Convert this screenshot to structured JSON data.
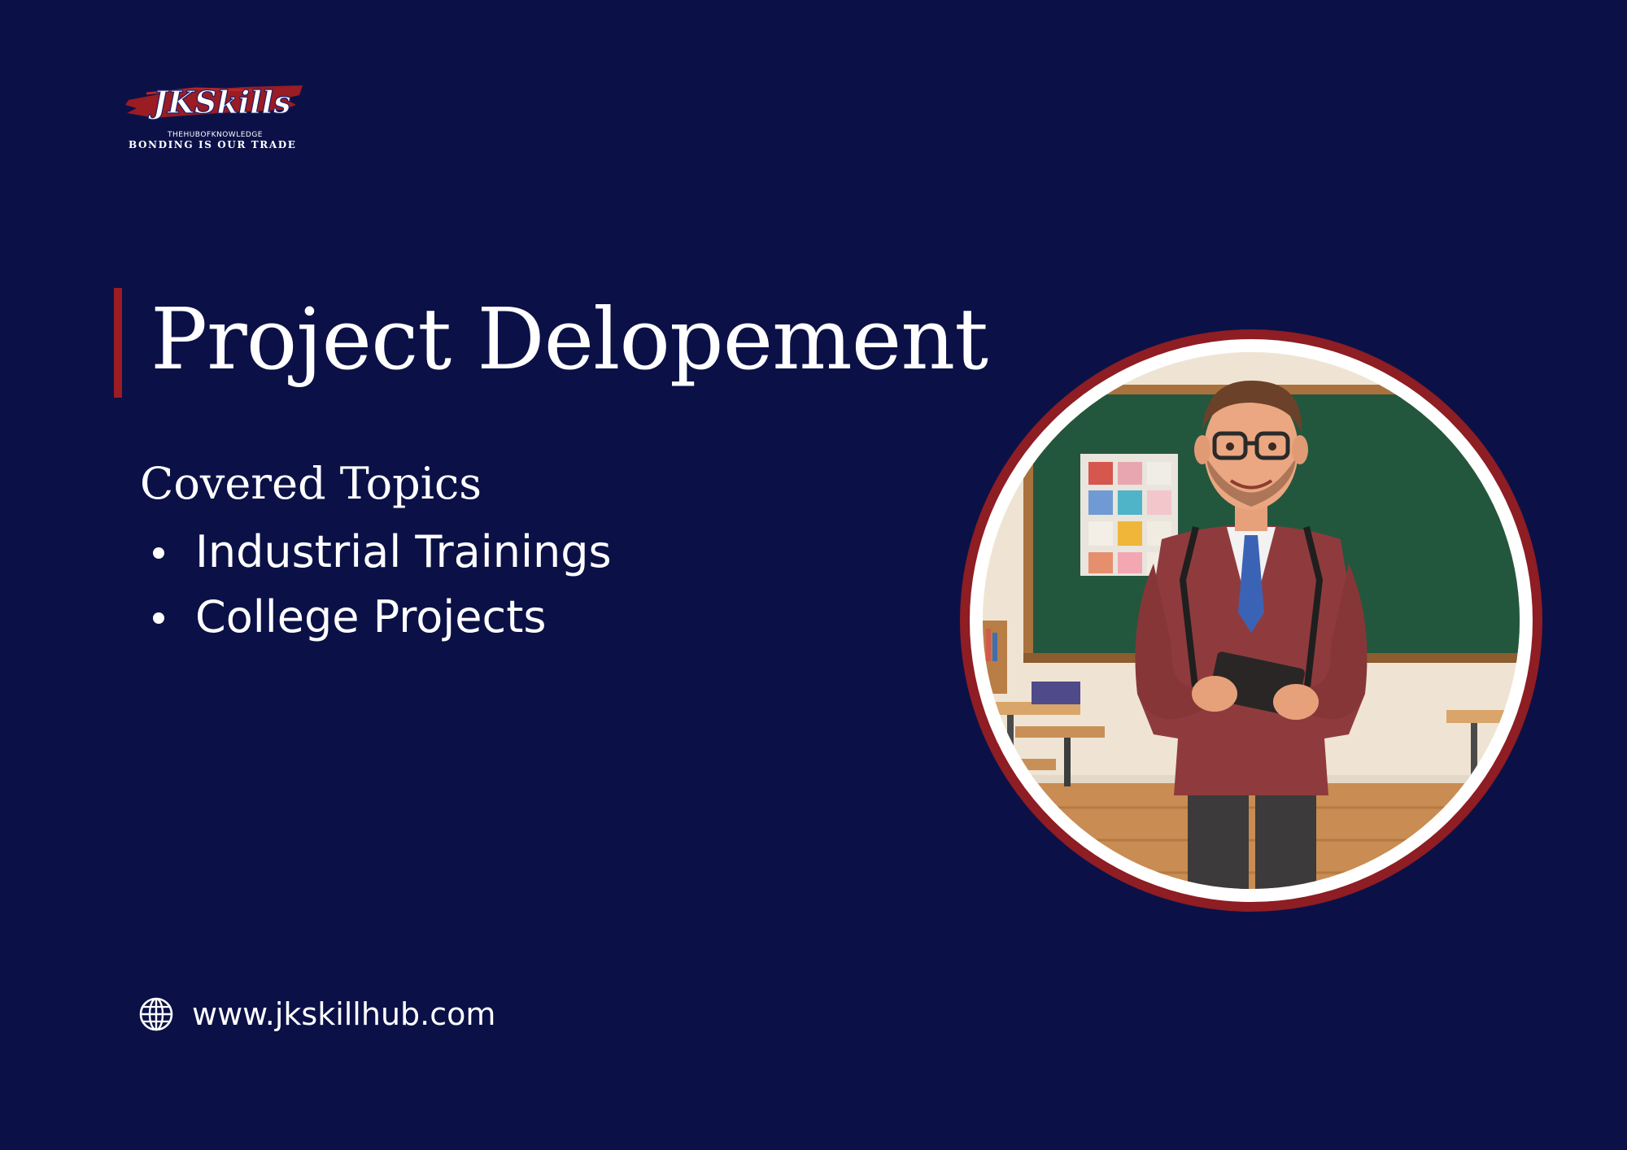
{
  "logo": {
    "brand": "JKSkills",
    "tagline_small": "THEHUBOFKNOWLEDGE",
    "tagline": "BONDING IS OUR TRADE"
  },
  "title": "Project Delopement",
  "topics": {
    "heading": "Covered Topics",
    "items": [
      {
        "label": "Industrial Trainings"
      },
      {
        "label": "College Projects"
      }
    ]
  },
  "footer": {
    "website": "www.jkskillhub.com",
    "icon": "globe-icon"
  },
  "colors": {
    "background": "#0b1147",
    "accent": "#9b1c22",
    "text": "#ffffff"
  },
  "illustration": {
    "subject": "teacher-illustration"
  }
}
